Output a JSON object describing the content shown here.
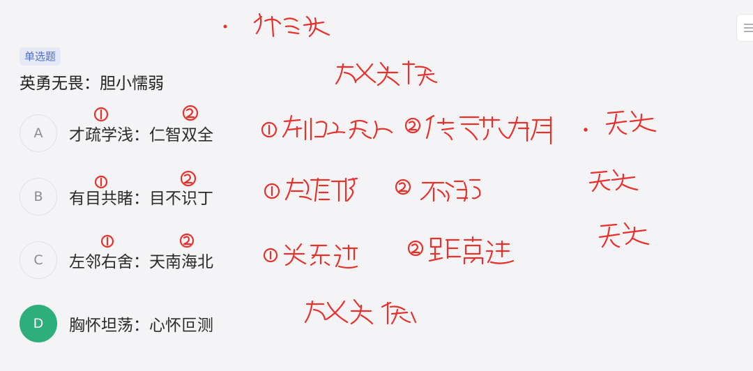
{
  "question": {
    "type_tag": "单选题",
    "stem": "英勇无畏：胆小懦弱"
  },
  "options": [
    {
      "letter": "A",
      "text": "才疏学浅：仁智双全",
      "selected": false
    },
    {
      "letter": "B",
      "text": "有目共睹：目不识丁",
      "selected": false
    },
    {
      "letter": "C",
      "text": "左邻右舍：天南海北",
      "selected": false
    },
    {
      "letter": "D",
      "text": "胸怀坦荡：心怀叵测",
      "selected": true
    }
  ],
  "colors": {
    "selected": "#2fae7d",
    "tag_bg": "#e5e9f7",
    "tag_text": "#4e6cd6",
    "handwriting": "#e8302a"
  },
  "icons": {
    "menu": "menu-lines-icon"
  }
}
